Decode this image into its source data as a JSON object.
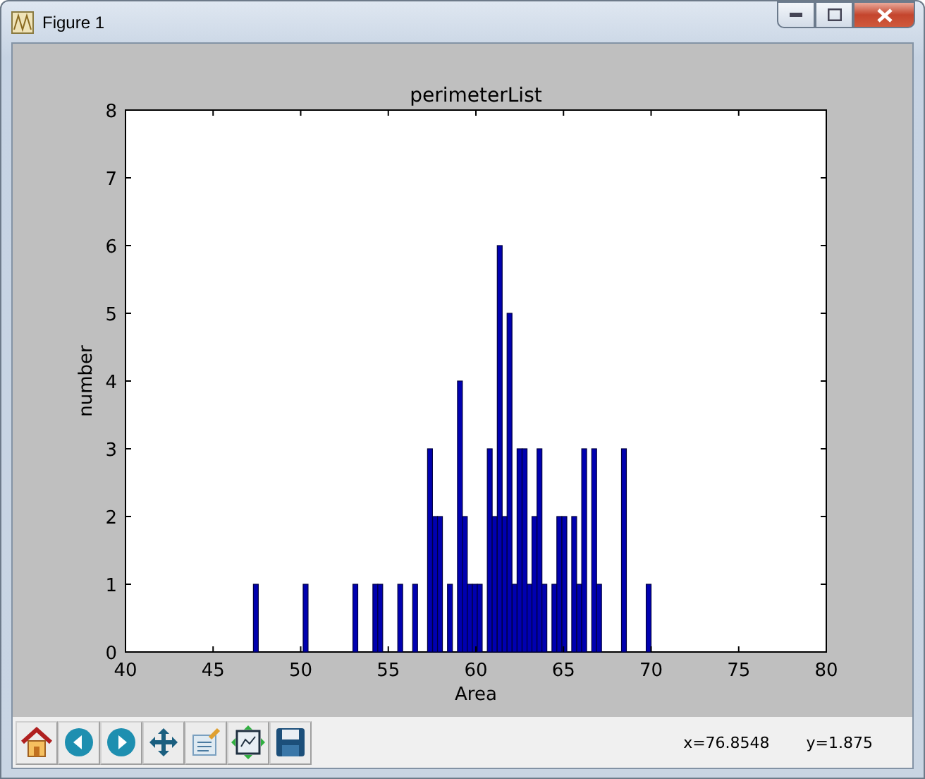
{
  "window": {
    "title": "Figure 1"
  },
  "figure": {
    "chart_data": {
      "type": "bar",
      "title": "perimeterList",
      "xlabel": "Area",
      "ylabel": "number",
      "x": [
        47.44,
        50.28,
        53.12,
        54.26,
        54.54,
        55.68,
        56.53,
        57.38,
        57.67,
        57.95,
        58.52,
        59.09,
        59.37,
        59.65,
        59.94,
        60.22,
        60.79,
        61.07,
        61.36,
        61.64,
        61.92,
        62.21,
        62.49,
        62.78,
        63.06,
        63.34,
        63.63,
        63.91,
        64.48,
        64.76,
        65.05,
        65.61,
        65.9,
        66.18,
        66.75,
        67.03,
        68.45,
        69.86
      ],
      "values": [
        1,
        1,
        1,
        1,
        1,
        1,
        1,
        3,
        2,
        2,
        1,
        4,
        2,
        1,
        1,
        1,
        3,
        2,
        6,
        2,
        5,
        1,
        3,
        3,
        1,
        2,
        3,
        1,
        1,
        2,
        2,
        2,
        1,
        3,
        3,
        1,
        3,
        1
      ],
      "xlim": [
        40,
        80
      ],
      "ylim": [
        0,
        8
      ],
      "xticks": [
        40,
        45,
        50,
        55,
        60,
        65,
        70,
        75,
        80
      ],
      "yticks": [
        0,
        1,
        2,
        3,
        4,
        5,
        6,
        7,
        8
      ]
    }
  },
  "toolbar": {
    "buttons": [
      {
        "kind": "home"
      },
      {
        "kind": "back"
      },
      {
        "kind": "forward"
      },
      {
        "kind": "pan"
      },
      {
        "kind": "subplots"
      },
      {
        "kind": "zoom"
      },
      {
        "kind": "save"
      }
    ]
  },
  "status": {
    "x_reading": "x=76.8548",
    "y_reading": "y=1.875"
  }
}
